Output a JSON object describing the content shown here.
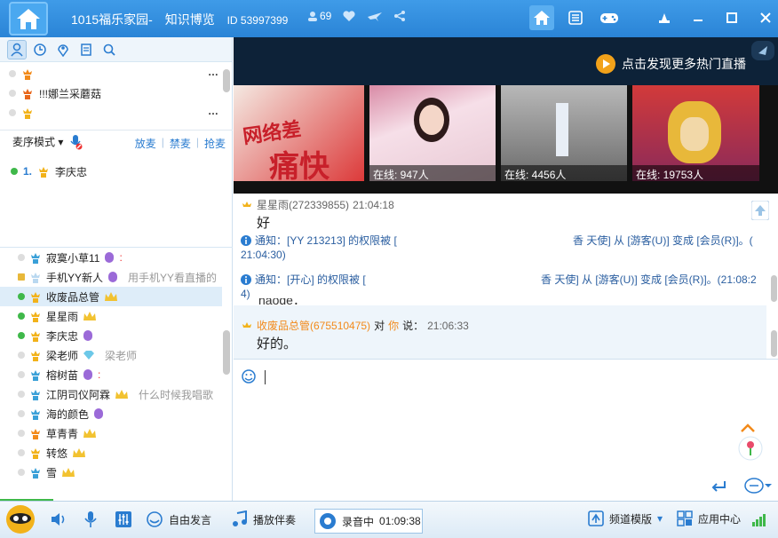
{
  "titlebar": {
    "channel_name": "1015福乐家园-",
    "subtitle": "知识博览",
    "id_text": "ID 53997399",
    "online_count": "69"
  },
  "left_tabs": [
    "user-icon",
    "clock-icon",
    "location-icon",
    "notes-icon",
    "search-icon"
  ],
  "channels": [
    {
      "name": "",
      "icon": "crown-user-orange"
    },
    {
      "name": "!!!娜兰采蘑菇",
      "icon": "crown-user-orange"
    },
    {
      "name": "",
      "icon": "crown-user-yellow"
    }
  ],
  "mic": {
    "mode_label": "麦序模式",
    "links": [
      "放麦",
      "禁麦",
      "抢麦"
    ],
    "queue": [
      {
        "num": "1.",
        "name": "李庆忠"
      }
    ]
  },
  "users": [
    {
      "name": "寂寞小草11",
      "sig": "",
      "status": "idle"
    },
    {
      "name": "手机YY新人",
      "sig": "用手机YY看直播的",
      "status": "idle"
    },
    {
      "name": "收废品总管",
      "sig": "",
      "status": "green"
    },
    {
      "name": "星星雨",
      "sig": "",
      "status": "green"
    },
    {
      "name": "李庆忠",
      "sig": "",
      "status": "green"
    },
    {
      "name": "梁老师",
      "sig": "梁老师",
      "status": "idle"
    },
    {
      "name": "榕树苗",
      "sig": "",
      "status": "idle"
    },
    {
      "name": "江阴司仪阿霖",
      "sig": "什么时候我唱歌",
      "status": "idle"
    },
    {
      "name": "海的颜色",
      "sig": "",
      "status": "idle"
    },
    {
      "name": "草青青",
      "sig": "",
      "status": "idle"
    },
    {
      "name": "转悠",
      "sig": "",
      "status": "idle"
    },
    {
      "name": "雪",
      "sig": "",
      "status": "idle"
    }
  ],
  "banner": {
    "promo_text": "点击发现更多热门直播"
  },
  "thumbnails": [
    {
      "caption_top": "网络差",
      "caption_bottom": "痛快"
    },
    {
      "online": "在线: 947人"
    },
    {
      "online": "在线: 4456人"
    },
    {
      "online": "在线: 19753人"
    }
  ],
  "chat": {
    "m1_name": "星星雨(272339855)",
    "m1_time": "21:04:18",
    "m1_text": "好",
    "n1_left": "通知：[YY 213213] 的权限被 [",
    "n1_right": "香 天使] 从 [游客(U)] 变成 [会员(R)]。(",
    "n1_time": "21:04:30)",
    "n2_left": "通知：[开心] 的权限被 [",
    "n2_right": "香 天使] 从 [游客(U)] 变成 [会员(R)]。(21:08:2",
    "n2_time": "4)",
    "partial": "haode：",
    "m2_name": "收废品总管(675510475)",
    "m2_to": "对",
    "m2_you": "你",
    "m2_say": "说：",
    "m2_time": "21:06:33",
    "m2_text": "好的。"
  },
  "bottom": {
    "free_speak": "自由发言",
    "accompany": "播放伴奏",
    "record_label": "录音中",
    "record_time": "01:09:38",
    "template": "频道模版",
    "app_center": "应用中心"
  }
}
